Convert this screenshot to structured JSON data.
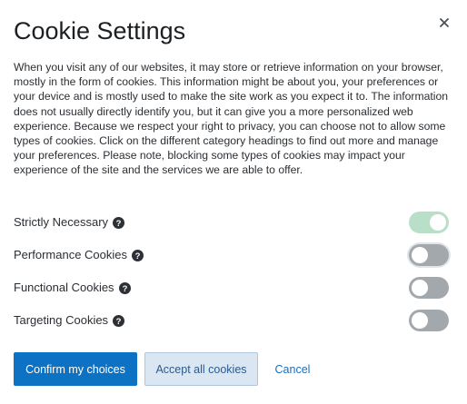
{
  "dialog": {
    "title": "Cookie Settings",
    "close_icon": "close-icon",
    "description": "When you visit any of our websites, it may store or retrieve information on your browser, mostly in the form of cookies. This information might be about you, your preferences or your device and is mostly used to make the site work as you expect it to. The information does not usually directly identify you, but it can give you a more personalized web experience. Because we respect your right to privacy, you can choose not to allow some types of cookies. Click on the different category headings to find out more and manage your preferences. Please note, blocking some types of cookies may impact your experience of the site and the services we are able to offer."
  },
  "categories": [
    {
      "label": "Strictly Necessary",
      "enabled": true,
      "locked": true,
      "icon": "help-icon"
    },
    {
      "label": "Performance Cookies",
      "enabled": false,
      "locked": false,
      "icon": "help-icon"
    },
    {
      "label": "Functional Cookies",
      "enabled": false,
      "locked": false,
      "icon": "help-icon"
    },
    {
      "label": "Targeting Cookies",
      "enabled": false,
      "locked": false,
      "icon": "help-icon"
    }
  ],
  "buttons": {
    "confirm": "Confirm my choices",
    "accept_all": "Accept all cookies",
    "cancel": "Cancel"
  },
  "colors": {
    "primary": "#0e72c4",
    "toggle_on": "#b9dfc8",
    "toggle_off": "#a3a8ad",
    "secondary_bg": "#dbe6f3"
  }
}
